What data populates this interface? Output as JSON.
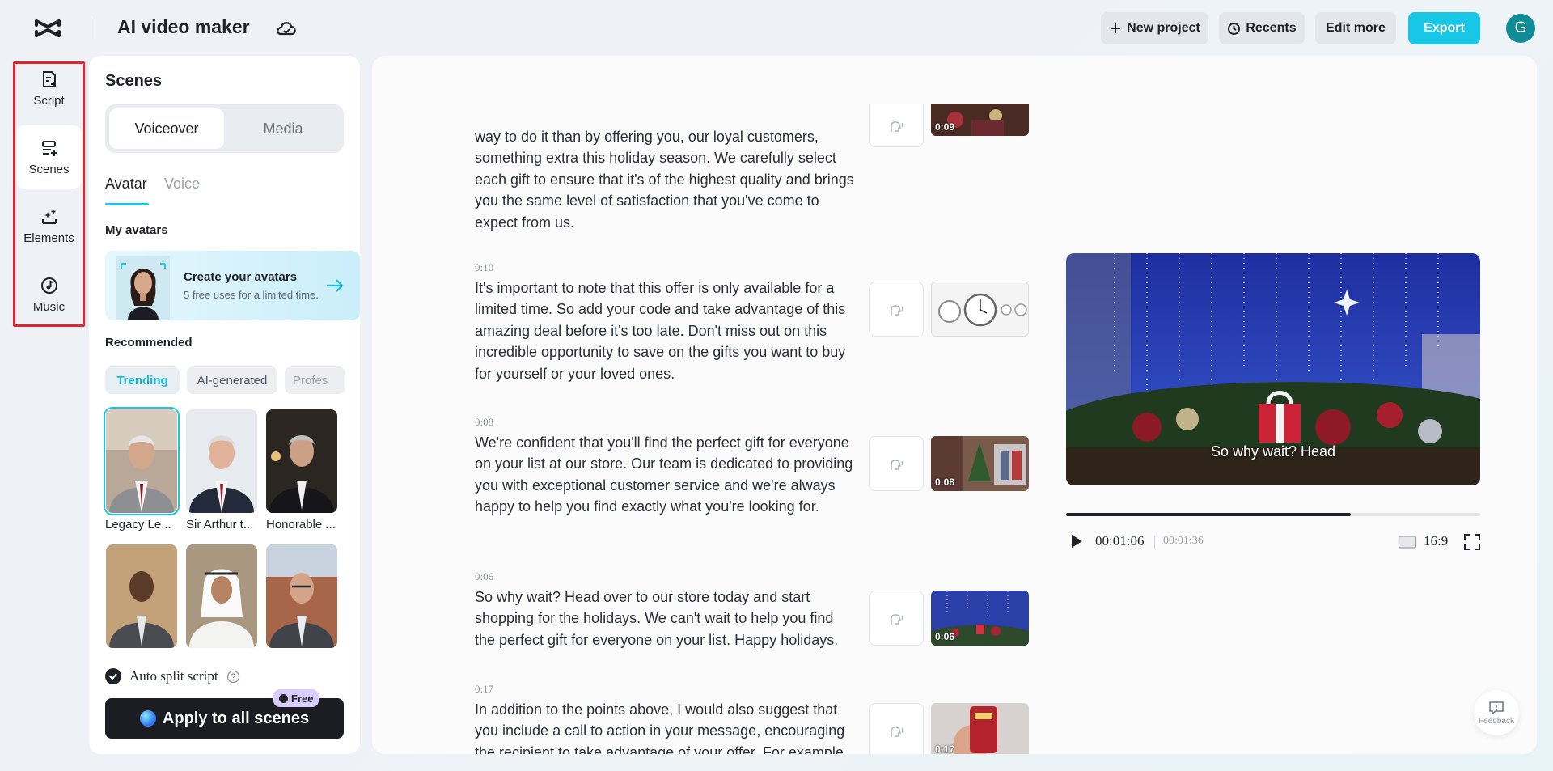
{
  "app": {
    "title": "AI video maker",
    "avatar_initial": "G"
  },
  "toolbar": {
    "new_project": "New project",
    "recents": "Recents",
    "edit_more": "Edit more",
    "export": "Export",
    "export_color": "#18c6e6"
  },
  "rail": {
    "items": [
      {
        "label": "Script",
        "icon": "script-icon",
        "active": false
      },
      {
        "label": "Scenes",
        "icon": "scenes-icon",
        "active": true
      },
      {
        "label": "Elements",
        "icon": "elements-icon",
        "active": false
      },
      {
        "label": "Music",
        "icon": "music-icon",
        "active": false
      }
    ]
  },
  "panel": {
    "title": "Scenes",
    "segments": [
      "Voiceover",
      "Media"
    ],
    "subtabs": [
      "Avatar",
      "Voice"
    ],
    "my_avatars_label": "My avatars",
    "create_card": {
      "title": "Create your avatars",
      "subtitle": "5 free uses for a limited time."
    },
    "recommended_label": "Recommended",
    "chips": [
      "Trending",
      "AI-generated",
      "Profes"
    ],
    "avatars": [
      {
        "label": "Legacy Le..."
      },
      {
        "label": "Sir Arthur t..."
      },
      {
        "label": "Honorable ..."
      },
      {
        "label": ""
      },
      {
        "label": ""
      },
      {
        "label": ""
      }
    ],
    "auto_split_label": "Auto split script",
    "apply_label": "Apply to all scenes",
    "free_badge": "Free"
  },
  "scenes": [
    {
      "time": "",
      "text": "way to do it than by offering you, our loyal customers, something extra this holiday season. We carefully select each gift to ensure that it's of the highest quality and brings you the same level of satisfaction that you've come to expect from us.",
      "thumb_duration": "0:09"
    },
    {
      "time": "0:10",
      "text": "It's important to note that this offer is only available for a limited time. So add your code and take advantage of this amazing deal before it's too late. Don't miss out on this incredible opportunity to save on the gifts you want to buy for yourself or your loved ones.",
      "thumb_duration": ""
    },
    {
      "time": "0:08",
      "text": "We're confident that you'll find the perfect gift for everyone on your list at our store. Our team is dedicated to providing you with exceptional customer service and we're always happy to help you find exactly what you're looking for.",
      "thumb_duration": "0:08"
    },
    {
      "time": "0:06",
      "text": "So why wait? Head over to our store today and start shopping for the holidays. We can't wait to help you find the perfect gift for everyone on your list. Happy holidays.",
      "thumb_duration": "0:06"
    },
    {
      "time": "0:17",
      "text": "In addition to the points above, I would also suggest that you include a call to action in your message, encouraging the recipient to take advantage of your offer. For example",
      "thumb_duration": "0:17"
    }
  ],
  "player": {
    "caption": "So why wait? Head",
    "current_time": "00:01:06",
    "total_time": "00:01:36",
    "progress": 0.6875,
    "aspect_ratio": "16:9"
  },
  "feedback": {
    "label": "Feedback"
  }
}
